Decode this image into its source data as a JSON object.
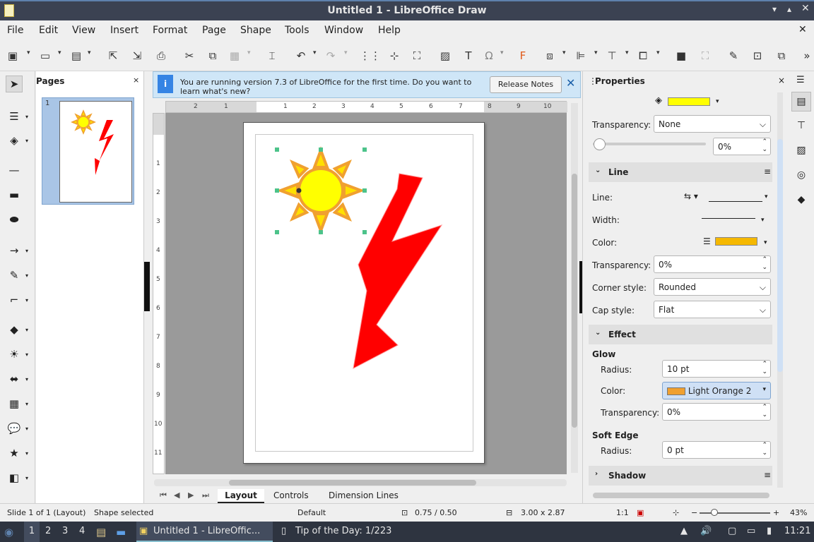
{
  "window": {
    "title": "Untitled 1 - LibreOffice Draw"
  },
  "menu": [
    "File",
    "Edit",
    "View",
    "Insert",
    "Format",
    "Page",
    "Shape",
    "Tools",
    "Window",
    "Help"
  ],
  "pages_panel": {
    "title": "Pages",
    "thumb_num": "1"
  },
  "infobar": {
    "text": "You are running version 7.3 of LibreOffice for the first time. Do you want to learn what's new?",
    "button": "Release Notes"
  },
  "ruler": {
    "h": [
      "2",
      "1",
      "1",
      "2",
      "3",
      "4",
      "5",
      "6",
      "7",
      "8",
      "9",
      "10"
    ],
    "v": [
      "1",
      "2",
      "3",
      "4",
      "5",
      "6",
      "7",
      "8",
      "9",
      "10",
      "11"
    ]
  },
  "tabs": [
    "Layout",
    "Controls",
    "Dimension Lines"
  ],
  "sidebar": {
    "title": "Properties",
    "fill_color": "#ffff00",
    "transparency_label": "Transparency:",
    "transparency_value": "None",
    "transparency_pct": "0%",
    "line_section": "Line",
    "line_label": "Line:",
    "width_label": "Width:",
    "color_label": "Color:",
    "line_color": "#f5b800",
    "line_transp_label": "Transparency:",
    "line_transp_value": "0%",
    "corner_label": "Corner style:",
    "corner_value": "Rounded",
    "cap_label": "Cap style:",
    "cap_value": "Flat",
    "effect_section": "Effect",
    "glow_label": "Glow",
    "radius_label": "Radius:",
    "radius_value": "10 pt",
    "glow_color_label": "Color:",
    "glow_color_value": "Light Orange 2",
    "glow_color": "#f0a030",
    "glow_transp_label": "Transparency:",
    "glow_transp_value": "0%",
    "soft_label": "Soft Edge",
    "soft_radius_label": "Radius:",
    "soft_radius_value": "0 pt",
    "shadow_section": "Shadow"
  },
  "status": {
    "slide": "Slide 1 of 1 (Layout)",
    "selection": "Shape selected",
    "master": "Default",
    "pos": "0.75 / 0.50",
    "size": "3.00 x 2.87",
    "scale": "1:1",
    "zoom": "43%"
  },
  "taskbar": {
    "ws": [
      "1",
      "2",
      "3",
      "4"
    ],
    "app1": "Untitled 1 - LibreOffic...",
    "app2": "Tip of the Day: 1/223",
    "clock": "11:21"
  }
}
